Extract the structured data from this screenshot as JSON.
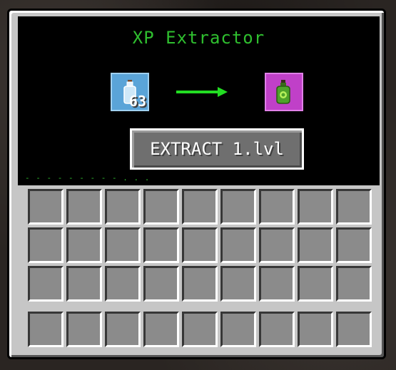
{
  "title": "XP Extractor",
  "input_slot": {
    "icon": "empty-bottle-icon",
    "count": "63"
  },
  "output_slot": {
    "icon": "xp-bottle-icon"
  },
  "extract_button": {
    "label": "EXTRACT 1.lvl"
  },
  "status_text": "- - - - - - - - -  . . .",
  "inventory_rows": 3,
  "inventory_cols": 9,
  "hotbar_slots": 9,
  "colors": {
    "title_green": "#2fbf2f",
    "input_slot_blue": "#5aa4d8",
    "output_slot_magenta": "#c040c8",
    "arrow_green": "#22dd22"
  }
}
